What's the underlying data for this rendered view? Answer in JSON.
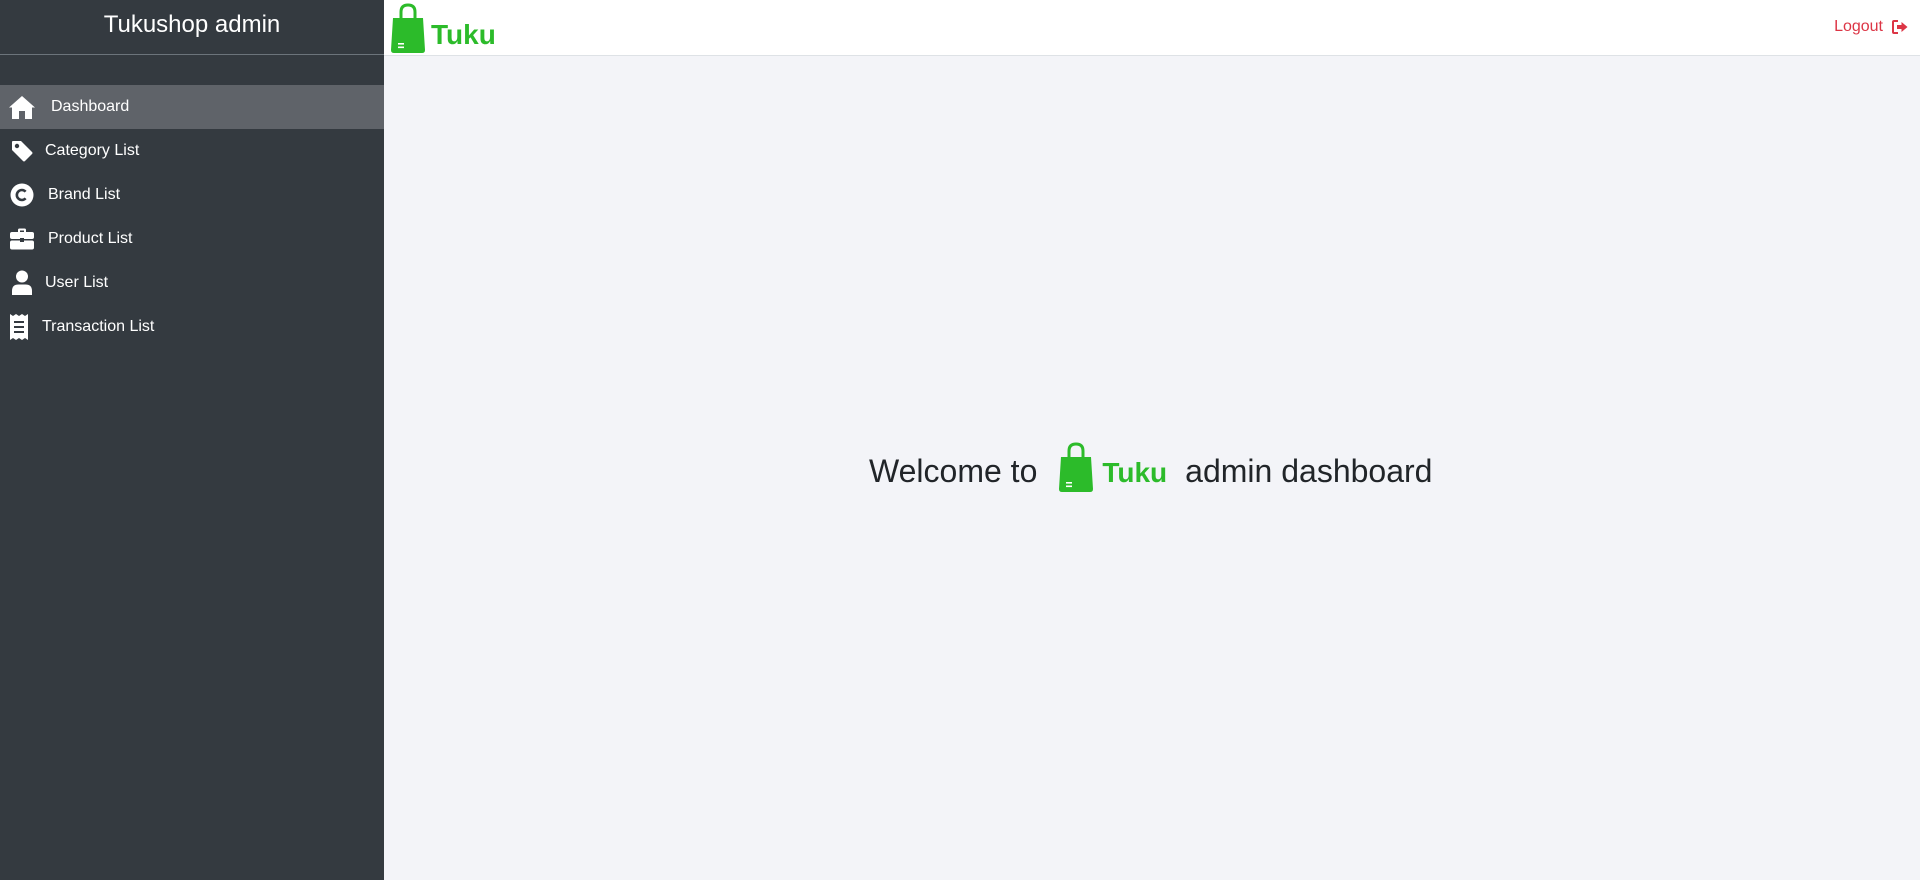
{
  "sidebar": {
    "title": "Tukushop admin",
    "items": [
      {
        "label": "Dashboard",
        "icon": "home-icon",
        "active": true
      },
      {
        "label": "Category List",
        "icon": "tag-icon",
        "active": false
      },
      {
        "label": "Brand List",
        "icon": "copyright-icon",
        "active": false
      },
      {
        "label": "Product List",
        "icon": "briefcase-icon",
        "active": false
      },
      {
        "label": "User List",
        "icon": "user-icon",
        "active": false
      },
      {
        "label": "Transaction List",
        "icon": "receipt-icon",
        "active": false
      }
    ]
  },
  "topbar": {
    "brand_name": "Tuku",
    "logout_label": "Logout",
    "logout_icon": "sign-out-icon"
  },
  "welcome": {
    "prefix": "Welcome to",
    "brand_name": "Tuku",
    "suffix": "admin dashboard"
  },
  "colors": {
    "sidebar_bg": "#343a40",
    "sidebar_active": "#5f6369",
    "brand_green": "#2cbb2a",
    "logout_red": "#dc3545",
    "main_bg": "#f3f4f8"
  }
}
